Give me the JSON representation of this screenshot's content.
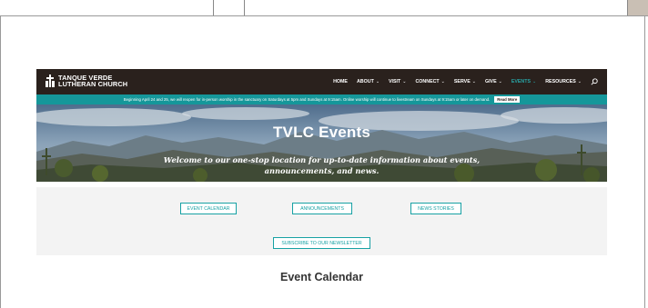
{
  "site": {
    "logo_line1": "TANQUE VERDE",
    "logo_line2": "LUTHERAN CHURCH",
    "nav": [
      {
        "label": "HOME",
        "dropdown": false,
        "active": false
      },
      {
        "label": "ABOUT",
        "dropdown": true,
        "active": false
      },
      {
        "label": "VISIT",
        "dropdown": true,
        "active": false
      },
      {
        "label": "CONNECT",
        "dropdown": true,
        "active": false
      },
      {
        "label": "SERVE",
        "dropdown": true,
        "active": false
      },
      {
        "label": "GIVE",
        "dropdown": true,
        "active": false
      },
      {
        "label": "EVENTS",
        "dropdown": true,
        "active": true
      },
      {
        "label": "RESOURCES",
        "dropdown": true,
        "active": false
      }
    ],
    "search_icon": "search-icon"
  },
  "notice": {
    "text": "Beginning April 24 and 25, we will reopen for in-person worship in the sanctuary on Saturdays at 5pm and Sundays at 9:15am. Online worship will continue to livestream on Sundays at 9:15am or later on demand.",
    "read_more": "Read More"
  },
  "hero": {
    "title": "TVLC Events",
    "subtitle_line1": "Welcome to our one-stop location for up-to-date information about events,",
    "subtitle_line2": "announcements, and news."
  },
  "buttons": {
    "event_calendar": "EVENT CALENDAR",
    "announcements": "ANNOUNCEMENTS",
    "news_stories": "NEWS STORIES",
    "subscribe": "SUBSCRIBE TO OUR NEWSLETTER"
  },
  "section": {
    "title": "Event Calendar"
  },
  "colors": {
    "topbar": "#2a211d",
    "accent": "#15979a",
    "button_border": "#17a1a4"
  }
}
